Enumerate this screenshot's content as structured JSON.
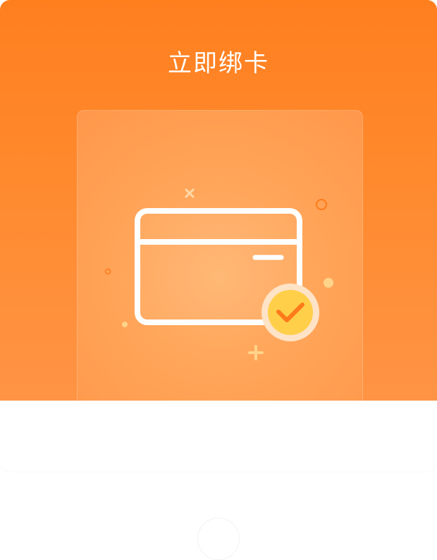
{
  "dialog": {
    "title": "立即绑卡",
    "illustration": {
      "card_icon": "bank-card-icon",
      "badge_icon": "checkmark-icon"
    }
  },
  "colors": {
    "header_top": "#ff7f1f",
    "header_bottom": "#ff9445",
    "badge_fill": "#ffcf4a",
    "check_stroke": "#ff7a1a"
  },
  "close_button": {
    "icon": "close-circle-button"
  }
}
